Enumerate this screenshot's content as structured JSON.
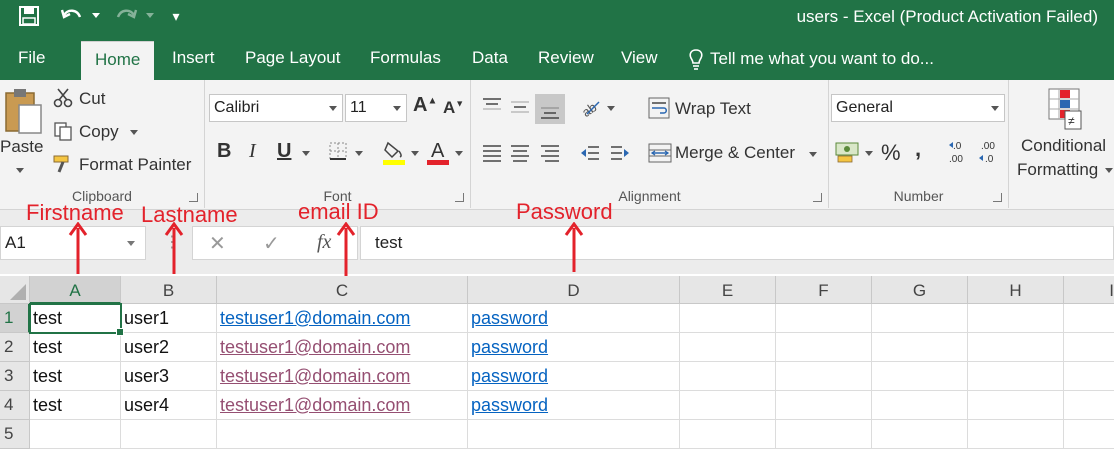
{
  "window": {
    "title": "users - Excel (Product Activation Failed)"
  },
  "colors": {
    "accent": "#217346",
    "link": "#0563c1",
    "visited_link": "#954f72",
    "annotation": "#e3222b"
  },
  "tabs": [
    "File",
    "Home",
    "Insert",
    "Page Layout",
    "Formulas",
    "Data",
    "Review",
    "View"
  ],
  "tell_me": "Tell me what you want to do...",
  "clipboard": {
    "paste": "Paste",
    "cut": "Cut",
    "copy": "Copy",
    "format_painter": "Format Painter",
    "label": "Clipboard"
  },
  "font": {
    "name": "Calibri",
    "size": "11",
    "bold": "B",
    "italic": "I",
    "underline": "U",
    "label": "Font"
  },
  "alignment": {
    "wrap_text": "Wrap Text",
    "merge_center": "Merge & Center",
    "label": "Alignment"
  },
  "number": {
    "format": "General",
    "label": "Number"
  },
  "styles": {
    "conditional_line1": "Conditional",
    "conditional_line2": "Formatting"
  },
  "formula_bar": {
    "name_box": "A1",
    "fx": "fx",
    "value": "test"
  },
  "columns": [
    "A",
    "B",
    "C",
    "D",
    "E",
    "F",
    "G",
    "H",
    "I"
  ],
  "rows": [
    {
      "num": "1",
      "a": "test",
      "b": "user1",
      "c": "testuser1@domain.com",
      "d": "password"
    },
    {
      "num": "2",
      "a": "test",
      "b": "user2",
      "c": "testuser1@domain.com",
      "d": "password"
    },
    {
      "num": "3",
      "a": "test",
      "b": "user3",
      "c": "testuser1@domain.com",
      "d": "password"
    },
    {
      "num": "4",
      "a": "test",
      "b": "user4",
      "c": "testuser1@domain.com",
      "d": "password"
    },
    {
      "num": "5",
      "a": "",
      "b": "",
      "c": "",
      "d": ""
    }
  ],
  "annotations": [
    "Firstname",
    "Lastname",
    "email ID",
    "Password"
  ]
}
